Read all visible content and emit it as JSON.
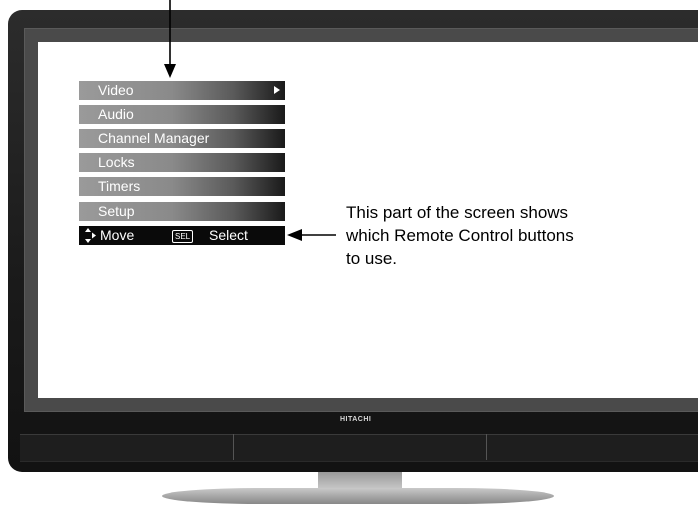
{
  "tv": {
    "brand": "HITACHI"
  },
  "menu": {
    "items": [
      {
        "label": "Video",
        "has_submenu": true
      },
      {
        "label": "Audio"
      },
      {
        "label": "Channel Manager"
      },
      {
        "label": "Locks"
      },
      {
        "label": "Timers"
      },
      {
        "label": "Setup"
      }
    ],
    "nav": {
      "move_label": "Move",
      "sel_badge": "SEL",
      "select_label": "Select"
    }
  },
  "caption": "This part of the screen shows which Remote Control buttons to use.",
  "colors": {
    "menu_bar_light": "#9a9a9a",
    "menu_bar_dark": "#1a1a1a",
    "nav_bar": "#0a0a0a",
    "tv_frame": "#1a1a1a",
    "bezel": "#4a4a4a"
  }
}
